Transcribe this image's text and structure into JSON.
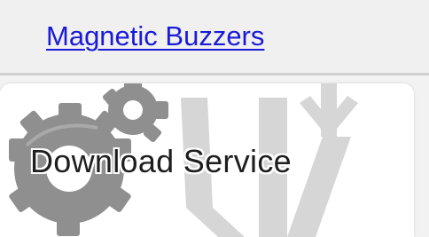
{
  "link": {
    "label": "Magnetic Buzzers",
    "color": "#1a1ad8"
  },
  "banner": {
    "label": "Download Service",
    "icons": [
      "gear-icon",
      "download-arrow-icon"
    ],
    "gear_color": "#8f8f8f",
    "arrow_color": "#d6d6d6"
  }
}
